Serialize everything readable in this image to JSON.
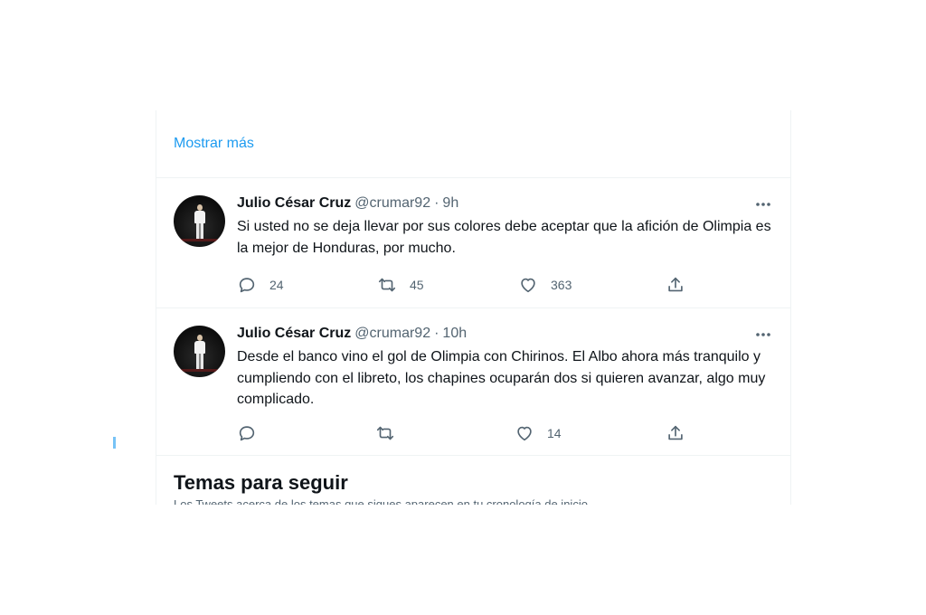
{
  "show_more": {
    "label": "Mostrar más"
  },
  "tweets": [
    {
      "name": "Julio César Cruz",
      "handle": "@crumar92",
      "separator": "·",
      "time": "9h",
      "text": "Si usted no se deja llevar por sus colores debe aceptar que la afición de Olimpia es la mejor de Honduras, por mucho.",
      "replies": "24",
      "retweets": "45",
      "likes": "363"
    },
    {
      "name": "Julio César Cruz",
      "handle": "@crumar92",
      "separator": "·",
      "time": "10h",
      "text": "Desde el banco vino el gol de Olimpia con Chirinos. El Albo ahora más tranquilo y cumpliendo con el libreto, los chapines ocuparán dos si quieren avanzar, algo muy complicado.",
      "replies": "",
      "retweets": "",
      "likes": "14"
    }
  ],
  "topics": {
    "title": "Temas para seguir",
    "subtitle": "Los Tweets acerca de los temas que sigues aparecen en tu cronología de inicio."
  },
  "icons": {
    "reply": "reply-icon",
    "retweet": "retweet-icon",
    "like": "like-icon",
    "share": "share-icon",
    "more": "more-options-icon"
  },
  "colors": {
    "accent": "#1d9bf0",
    "text_primary": "#0f1419",
    "text_secondary": "#536471",
    "divider": "#eff3f4"
  }
}
